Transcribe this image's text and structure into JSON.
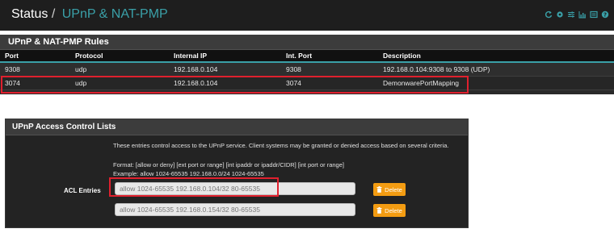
{
  "header": {
    "section": "Status",
    "separator": "/",
    "page": "UPnP & NAT-PMP",
    "icons": [
      "refresh-icon",
      "settings-icon",
      "sliders-icon",
      "chart-icon",
      "list-icon",
      "help-icon"
    ]
  },
  "rules": {
    "title": "UPnP & NAT-PMP Rules",
    "columns": [
      "Port",
      "Protocol",
      "Internal IP",
      "Int. Port",
      "Description"
    ],
    "rows": [
      {
        "port": "9308",
        "protocol": "udp",
        "internal_ip": "192.168.0.104",
        "int_port": "9308",
        "description": "192.168.0.104:9308 to 9308 (UDP)"
      },
      {
        "port": "3074",
        "protocol": "udp",
        "internal_ip": "192.168.0.104",
        "int_port": "3074",
        "description": "DemonwarePortMapping"
      }
    ]
  },
  "acl": {
    "title": "UPnP Access Control Lists",
    "help_text": "These entries control access to the UPnP service. Client systems may be granted or denied access based on several criteria.",
    "format_text": "Format: [allow or deny] [ext port or range] [int ipaddr or ipaddr/CIDR] [int port or range]",
    "example_text": "Example: allow 1024-65535 192.168.0.0/24 1024-65535",
    "entries_label": "ACL Entries",
    "entries": [
      {
        "value": "allow 1024-65535 192.168.0.104/32 80-65535",
        "delete_label": "Delete"
      },
      {
        "value": "allow 1024-65535 192.168.0.154/32 80-65535",
        "delete_label": "Delete"
      }
    ]
  },
  "colors": {
    "accent": "#3aa0a8",
    "highlight": "#e0202e",
    "delete_button": "#f39c12"
  }
}
